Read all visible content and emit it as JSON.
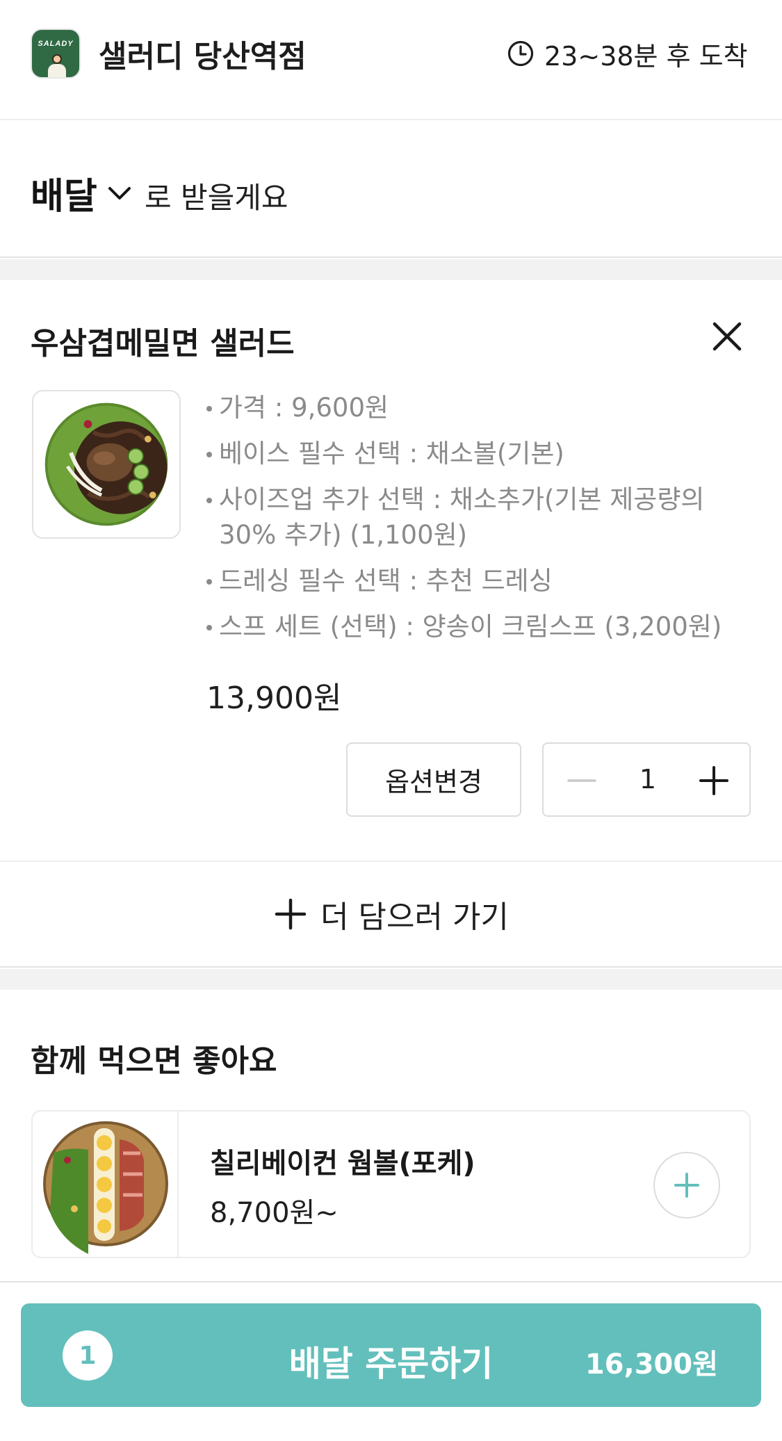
{
  "header": {
    "logo_text": "SALADY",
    "store_name": "샐러디 당산역점",
    "eta": "23~38분 후 도착"
  },
  "delivery": {
    "mode": "배달",
    "suffix": "로 받을게요"
  },
  "cart": {
    "items": [
      {
        "name": "우삼겹메밀면 샐러드",
        "options": [
          "가격 : 9,600원",
          "베이스 필수 선택 : 채소볼(기본)",
          "사이즈업 추가 선택 : 채소추가(기본 제공량의 30% 추가) (1,100원)",
          "드레싱 필수 선택 : 추천 드레싱",
          "스프 세트 (선택) : 양송이 크림스프 (3,200원)"
        ],
        "price": "13,900원",
        "quantity": "1",
        "change_option_label": "옵션변경"
      }
    ],
    "add_more_label": "더 담으러 가기"
  },
  "recommend": {
    "title": "함께 먹으면 좋아요",
    "items": [
      {
        "name": "칠리베이컨 웜볼(포케)",
        "price": "8,700원~"
      }
    ]
  },
  "order": {
    "count": "1",
    "label": "배달 주문하기",
    "total": "16,300원"
  },
  "colors": {
    "accent": "#63bfbb",
    "logo_green": "#2f6a45",
    "muted_text": "#8a8a8a",
    "divider": "#f2f2f2"
  },
  "icons": [
    "clock-icon",
    "chevron-down-icon",
    "close-icon",
    "minus-icon",
    "plus-icon"
  ]
}
